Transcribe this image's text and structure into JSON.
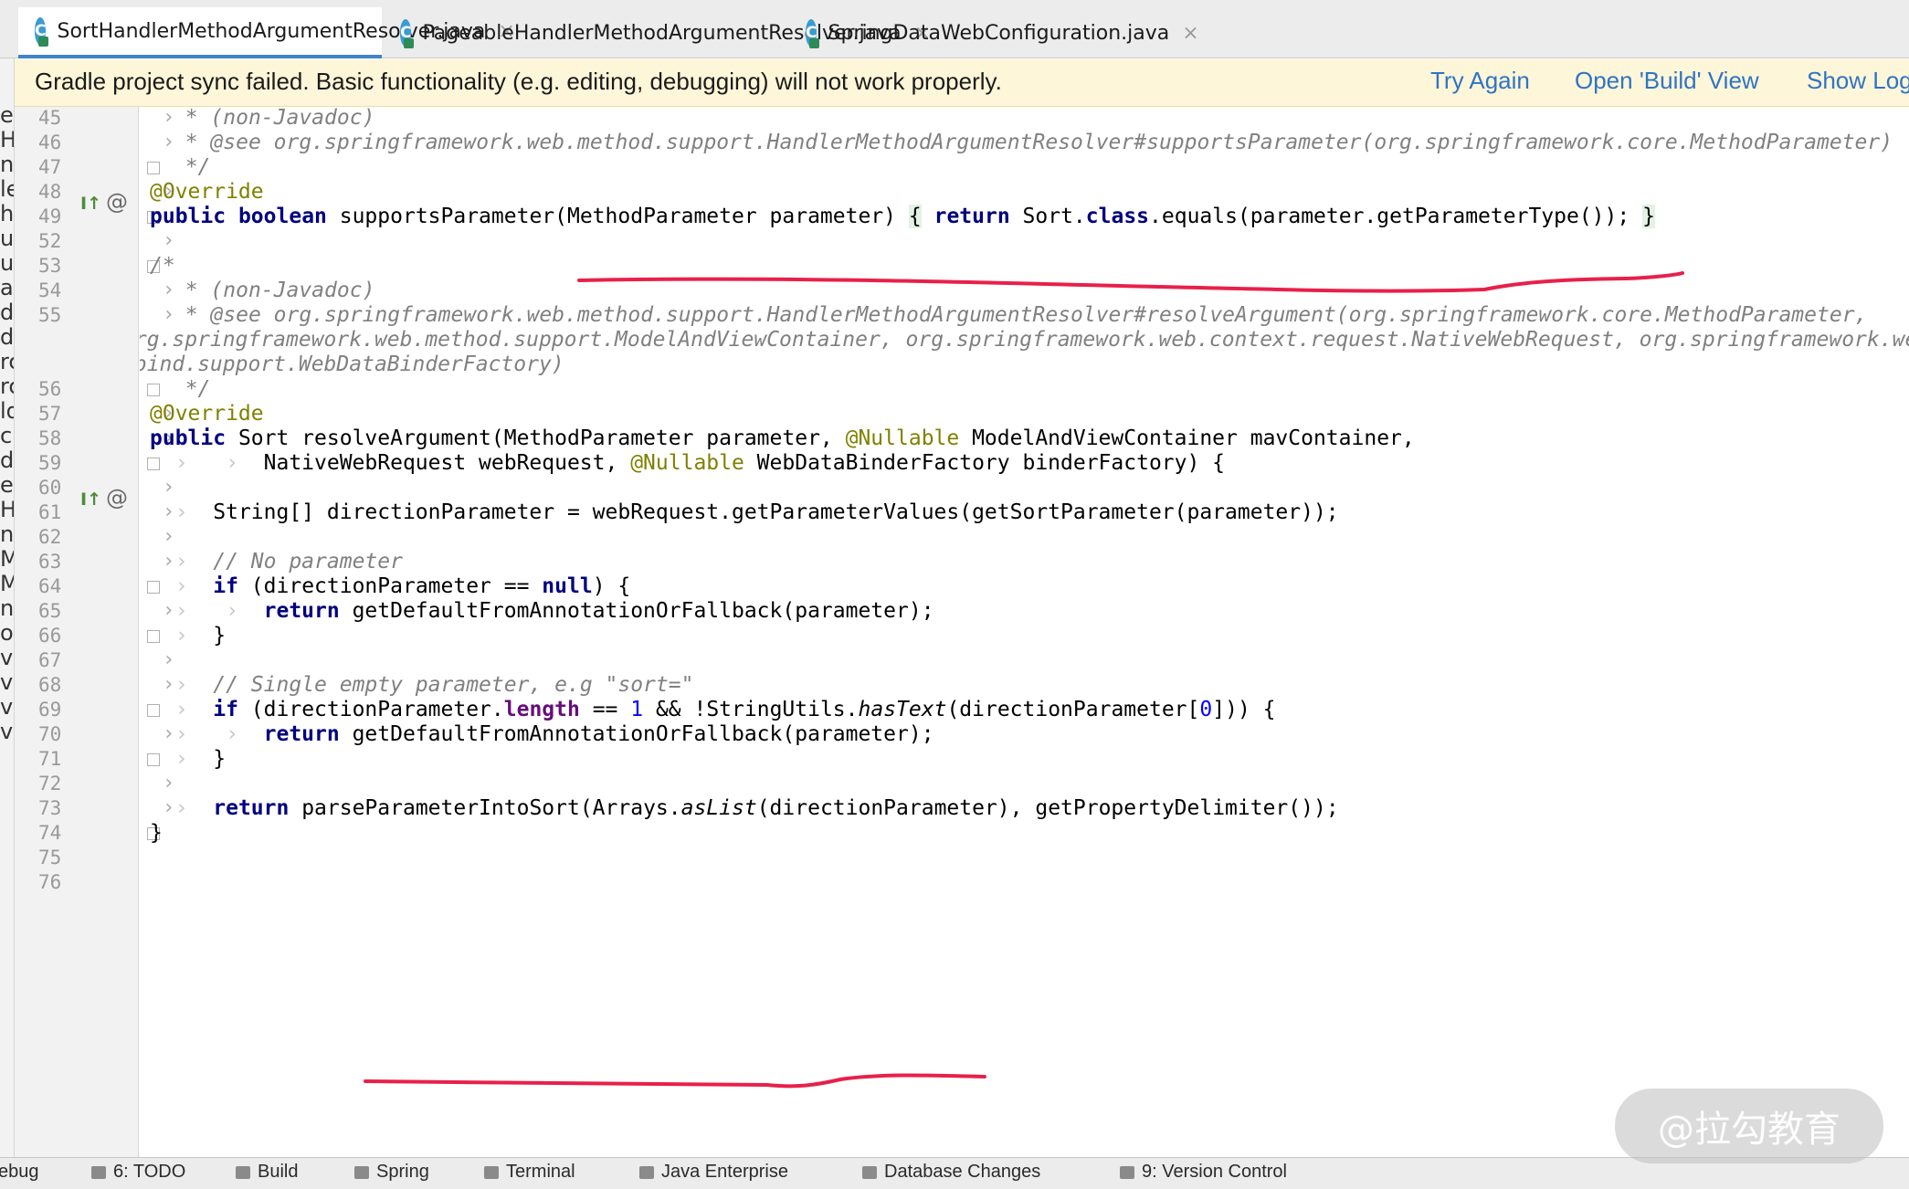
{
  "tabs": [
    {
      "label": "SortHandlerMethodArgumentResolver.java",
      "active": true,
      "icon": "java-class-icon"
    },
    {
      "label": "PageableHandlerMethodArgumentResolver.java",
      "active": false,
      "icon": "java-class-icon"
    },
    {
      "label": "SpringDataWebConfiguration.java",
      "active": false,
      "icon": "java-class-icon"
    }
  ],
  "tab_close_glyph": "×",
  "notification": {
    "message": "Gradle project sync failed. Basic functionality (e.g. editing, debugging) will not work properly.",
    "actions": [
      "Try Again",
      "Open 'Build' View",
      "Show Log"
    ]
  },
  "left_strip_chars": [
    "ea",
    "H",
    "ng",
    "le",
    "he",
    "ur",
    "ur",
    "au",
    "d",
    "d",
    "rc",
    "rc",
    "ld",
    "ck",
    "d",
    "ea",
    "H",
    "nt",
    "Me",
    "Me",
    "nt",
    "ol",
    "vc",
    "vc",
    "vc",
    "vc"
  ],
  "line_numbers": [
    "45",
    "46",
    "47",
    "48",
    "49",
    "52",
    "53",
    "54",
    "55",
    "56",
    "57",
    "58",
    "59",
    "60",
    "61",
    "62",
    "63",
    "64",
    "65",
    "66",
    "67",
    "68",
    "69",
    "70",
    "71",
    "72",
    "73",
    "74",
    "75",
    "76"
  ],
  "code": {
    "l45": "* (non-Javadoc)",
    "l46_a": "* @see ",
    "l46_b": "org.springframework.web.method.support.HandlerMethodArgumentResolver#supportsParameter(org.springframework.core.MethodParameter)",
    "l47": "*/",
    "l48": "@Override",
    "l49_kw1": "public",
    "l49_kw2": "boolean",
    "l49_sig": " supportsParameter(MethodParameter parameter) ",
    "l49_ob": "{",
    "l49_ret": "return",
    "l49_a": " Sort.",
    "l49_cls": "class",
    "l49_b": ".equals(parameter.getParameterType()); ",
    "l49_cb": "}",
    "l53": "/*",
    "l54": "* (non-Javadoc)",
    "l55_a": "* @see ",
    "l55_b": "org.springframework.web.method.support.HandlerMethodArgumentResolver#resolveArgument(org.springframework.core.MethodParameter,",
    "l55_c": "org.springframework.web.method.support.ModelAndViewContainer, org.springframework.web.context.request.NativeWebRequest, org.springframework.web",
    "l55_d": ".bind.support.WebDataBinderFactory)",
    "l56": "*/",
    "l57": "@Override",
    "l58_kw": "public",
    "l58_a": " Sort resolveArgument(MethodParameter parameter, ",
    "l58_an": "@Nullable",
    "l58_b": " ModelAndViewContainer mavContainer,",
    "l59_a": "NativeWebRequest webRequest, ",
    "l59_an": "@Nullable",
    "l59_b": " WebDataBinderFactory binderFactory) {",
    "l61": "String[] directionParameter = webRequest.getParameterValues(getSortParameter(parameter));",
    "l63": "// No parameter",
    "l64_kw": "if",
    "l64_a": " (directionParameter == ",
    "l64_null": "null",
    "l64_b": ") {",
    "l65_kw": "return",
    "l65_a": " getDefaultFromAnnotationOrFallback(parameter);",
    "l66": "}",
    "l68_a": "// Single empty parameter, e.g ",
    "l68_str": "\"sort=\"",
    "l69_kw": "if",
    "l69_a": " (directionParameter.",
    "l69_len": "length",
    "l69_b": " == ",
    "l69_one": "1",
    "l69_c": " && !StringUtils.",
    "l69_ht": "hasText",
    "l69_d": "(directionParameter[",
    "l69_zero": "0",
    "l69_e": "])) {",
    "l70_kw": "return",
    "l70_a": " getDefaultFromAnnotationOrFallback(parameter);",
    "l71": "}",
    "l73_kw": "return",
    "l73_a": " parseParameterIntoSort(Arrays.",
    "l73_as": "asList",
    "l73_b": "(directionParameter), getPropertyDelimiter());",
    "l74": "}",
    "l75": "}"
  },
  "bottom_tools": [
    "ebug",
    "6: TODO",
    "Build",
    "Spring",
    "Terminal",
    "Java Enterprise",
    "Database Changes",
    "9: Version Control"
  ],
  "watermark": "@拉勾教育",
  "annotation_color": "#e8204a"
}
